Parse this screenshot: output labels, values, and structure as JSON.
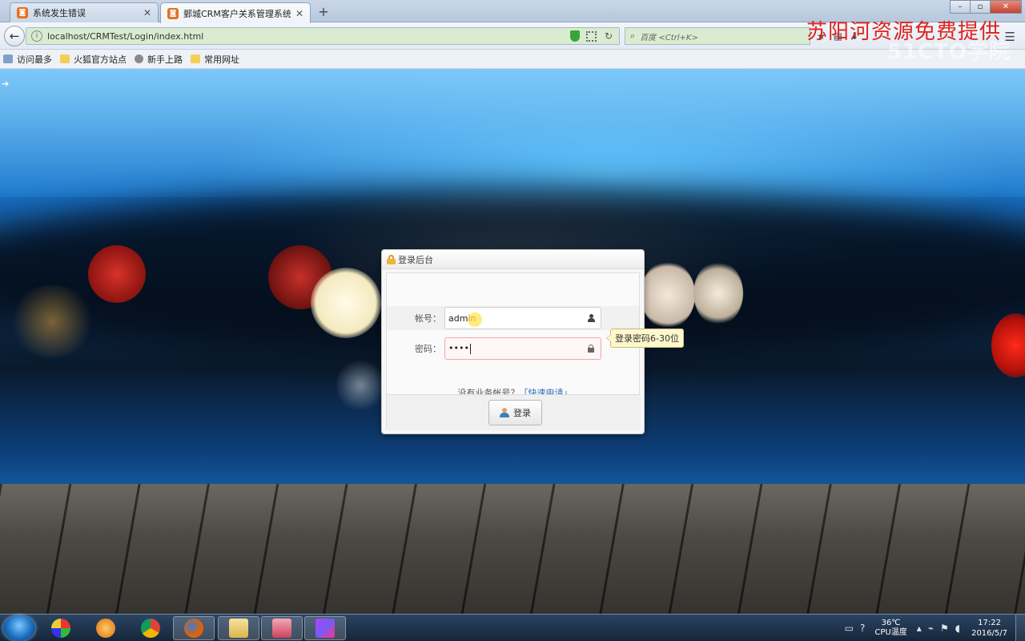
{
  "browser": {
    "tabs": [
      {
        "label": "系统发生错误",
        "active": false
      },
      {
        "label": "鄄城CRM客户关系管理系统",
        "active": true
      }
    ],
    "new_tab_symbol": "+",
    "url": "localhost/CRMTest/Login/index.html",
    "search_placeholder": "百度 <Ctrl+K>",
    "bookmarks": [
      "访问最多",
      "火狐官方站点",
      "新手上路",
      "常用网址"
    ]
  },
  "watermark": {
    "text": "苏阳河资源免费提供",
    "logo_text": "51CTO学院"
  },
  "login": {
    "title": "登录后台",
    "account_label": "帐号：",
    "account_value": "admin",
    "password_label": "密码：",
    "password_value": "••••",
    "password_tooltip": "登录密码6-30位",
    "no_account_text": "没有业务帐号？",
    "apply_link": "「快速申请」",
    "login_button": "登录"
  },
  "taskbar": {
    "cpu_temp": "36℃",
    "cpu_label": "CPU温度",
    "time": "17:22",
    "date": "2016/5/7"
  },
  "colors": {
    "watermark_red": "#e0231d",
    "link_blue": "#2a6ebb",
    "tab_icon_orange": "#e2701f",
    "tooltip_bg": "#fdf7cc"
  }
}
